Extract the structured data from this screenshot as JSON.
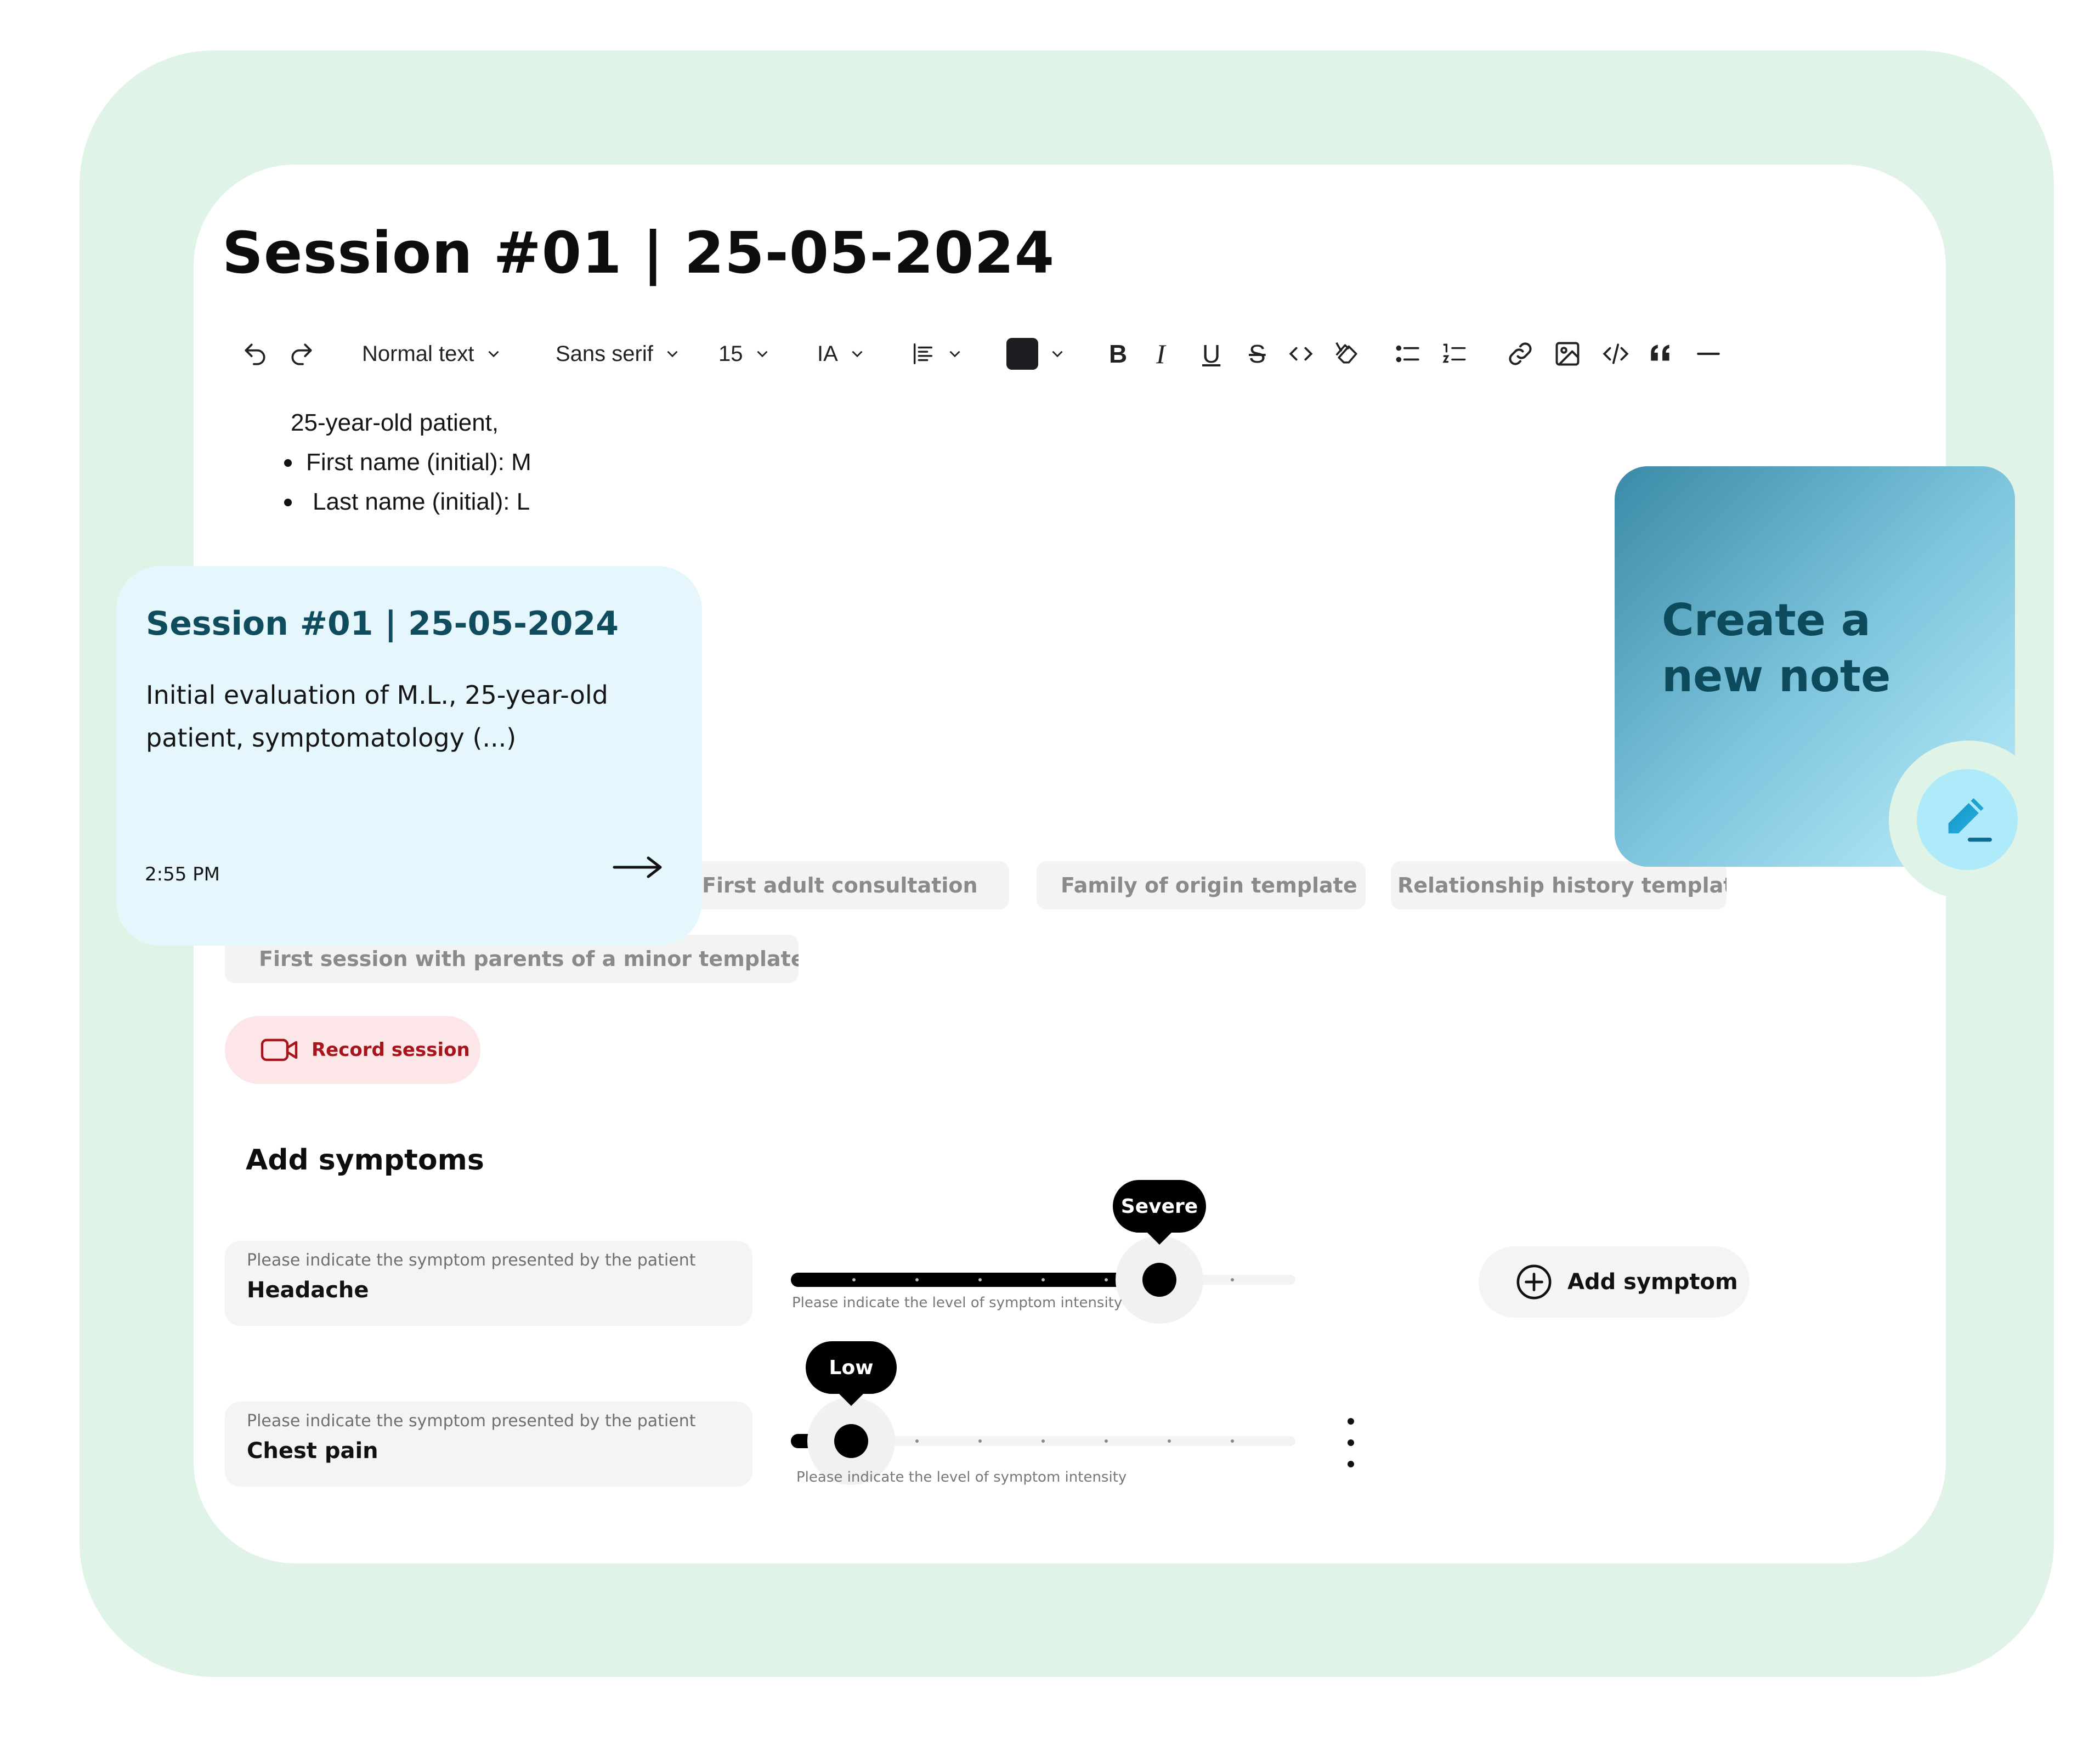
{
  "session": {
    "title": "Session #01 | 25-05-2024"
  },
  "toolbar": {
    "block_type": "Normal text",
    "font_family": "Sans serif",
    "font_size": "15",
    "text_case": "IA",
    "text_color": "#1e1e22",
    "bold": "B",
    "italic": "I",
    "underline": "U",
    "strikethrough": "S"
  },
  "editor": {
    "lines": [
      "25-year-old patient,",
      "First name (initial): M",
      "Last name (initial): L"
    ]
  },
  "templates": [
    "First adult consultation",
    "Family of origin template",
    "Relationship history template",
    "First session with parents of a minor template"
  ],
  "record": {
    "label": "Record session"
  },
  "symptoms": {
    "title": "Add symptoms",
    "field_placeholder": "Please indicate the symptom presented by the patient",
    "slider_hint": "Please indicate the level of symptom intensity",
    "add_label": "Add symptom",
    "rows": [
      {
        "name": "Headache",
        "level_label": "Severe",
        "level": 0.73
      },
      {
        "name": "Chest pain",
        "level_label": "Low",
        "level": 0.12
      }
    ]
  },
  "note_card": {
    "title": "Session #01 | 25-05-2024",
    "summary": "Initial evaluation of M.L., 25-year-old patient, symptomatology (...)",
    "time": "2:55 PM"
  },
  "create_note": {
    "label": "Create a new note"
  },
  "colors": {
    "frame": "#dff3e6",
    "brand_dark": "#0f4c5e",
    "record_bg": "#fde6e7",
    "record_text": "#a5151b",
    "note_bg": "#e6f6fd"
  }
}
